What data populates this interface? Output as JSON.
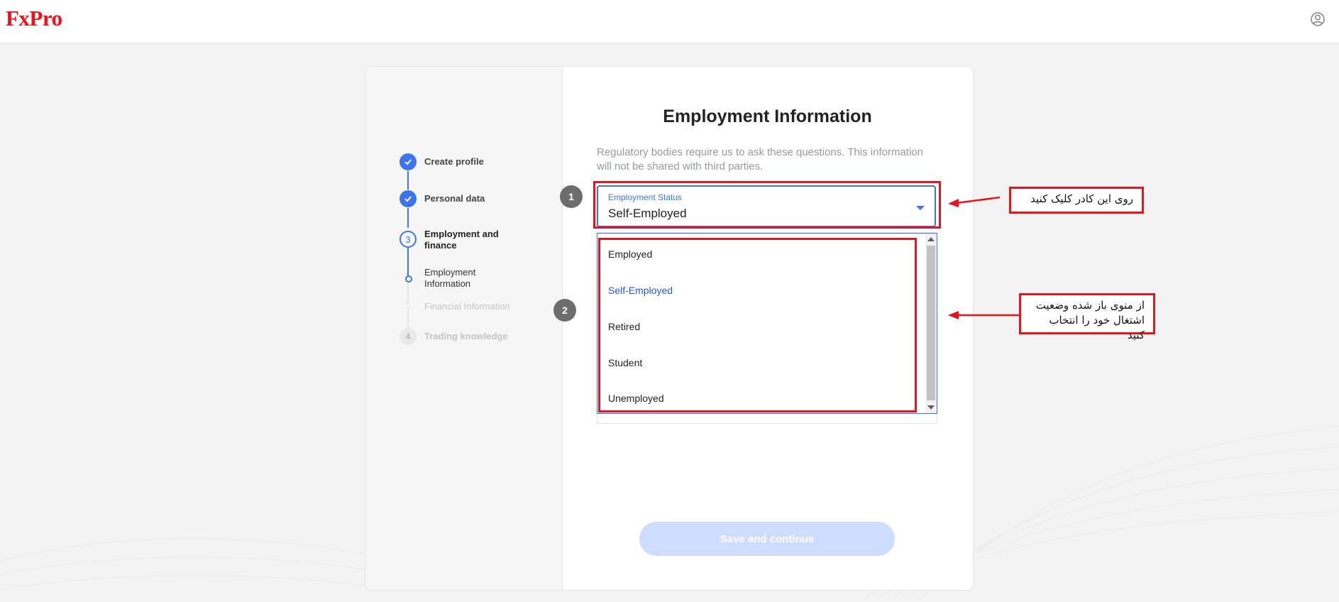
{
  "header": {
    "logo": "FxPro",
    "user_icon": "user-circle-icon"
  },
  "stepper": {
    "steps": [
      {
        "label": "Create profile",
        "state": "done"
      },
      {
        "label": "Personal data",
        "state": "done"
      },
      {
        "number": "3",
        "label": "Employment and finance",
        "state": "active"
      },
      {
        "number": "4",
        "label": "Trading knowledge",
        "state": "future"
      }
    ],
    "substeps": [
      {
        "label": "Employment Information",
        "state": "active"
      },
      {
        "label": "Financial Information",
        "state": "future"
      }
    ]
  },
  "form": {
    "title": "Employment Information",
    "intro": "Regulatory bodies require us to ask these questions. This information will not be shared with third parties.",
    "employment_status": {
      "label": "Employment Status",
      "value": "Self-Employed",
      "options": [
        "Employed",
        "Self-Employed",
        "Retired",
        "Student",
        "Unemployed"
      ],
      "selected_option": "Self-Employed"
    },
    "save_button": "Save and continue"
  },
  "annotations": {
    "badge_1": "1",
    "badge_2": "2",
    "callout_1": "روی این کادر کلیک کنید",
    "callout_2_line1": "از منوی باز شده وضعیت",
    "callout_2_line2": "اشتغال خود را انتخاب کنید"
  },
  "colors": {
    "brand": "#e8141c",
    "accent": "#3e73f0",
    "annotation_red": "#e8141c",
    "button_disabled": "#cddcff"
  }
}
